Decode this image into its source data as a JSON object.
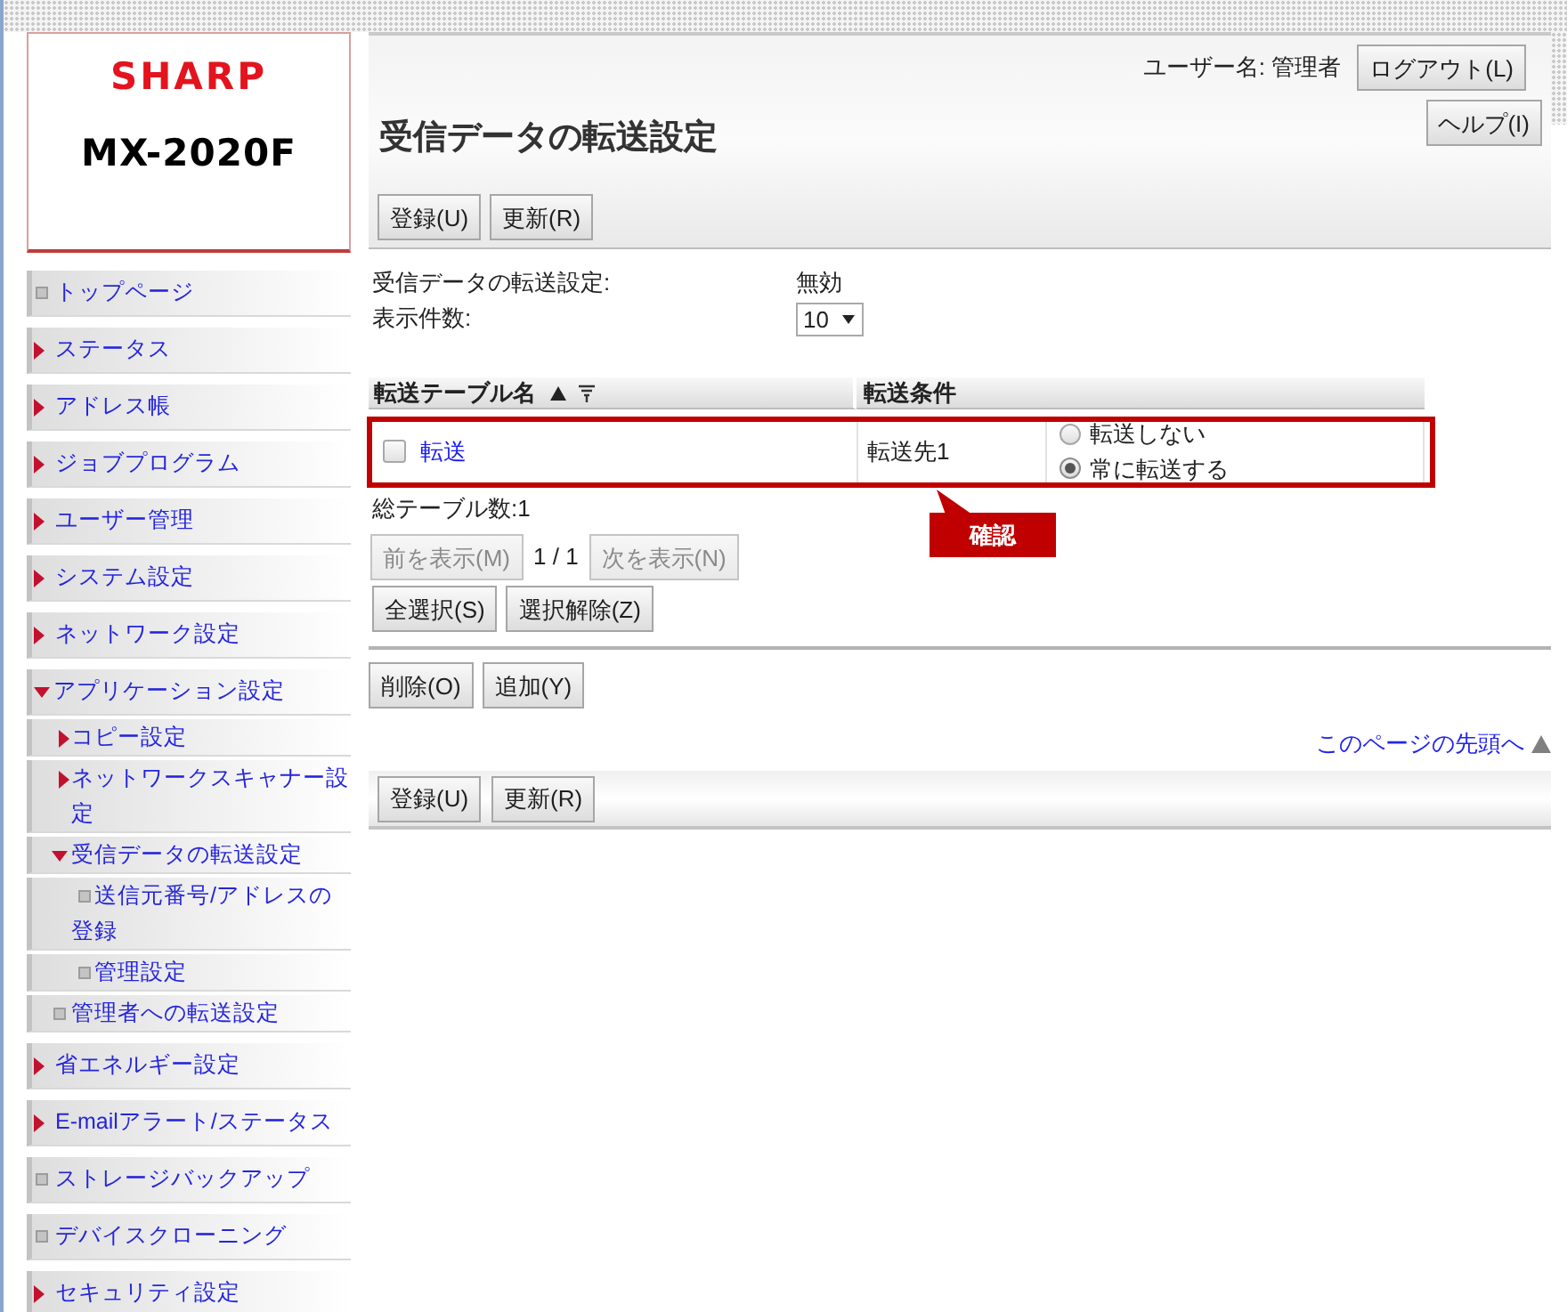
{
  "logo": {
    "brand": "SHARP",
    "model": "MX-2020F"
  },
  "sidebar": {
    "items": [
      {
        "label": "トップページ",
        "kind": "page"
      },
      {
        "label": "ステータス",
        "kind": "folder",
        "expanded": false
      },
      {
        "label": "アドレス帳",
        "kind": "folder",
        "expanded": false
      },
      {
        "label": "ジョブプログラム",
        "kind": "folder",
        "expanded": false
      },
      {
        "label": "ユーザー管理",
        "kind": "folder",
        "expanded": false
      },
      {
        "label": "システム設定",
        "kind": "folder",
        "expanded": false
      },
      {
        "label": "ネットワーク設定",
        "kind": "folder",
        "expanded": false
      },
      {
        "label": "アプリケーション設定",
        "kind": "folder",
        "expanded": true,
        "children": [
          {
            "label": "コピー設定",
            "kind": "folder",
            "expanded": false
          },
          {
            "label": "ネットワークスキャナー設定",
            "kind": "folder",
            "expanded": false
          },
          {
            "label": "受信データの転送設定",
            "kind": "folder",
            "expanded": true,
            "children": [
              {
                "label": "送信元番号/アドレスの登録",
                "kind": "page"
              },
              {
                "label": "管理設定",
                "kind": "page"
              }
            ]
          },
          {
            "label": "管理者への転送設定",
            "kind": "page"
          }
        ]
      },
      {
        "label": "省エネルギー設定",
        "kind": "folder",
        "expanded": false
      },
      {
        "label": "E-mailアラート/ステータス",
        "kind": "folder",
        "expanded": false
      },
      {
        "label": "ストレージバックアップ",
        "kind": "page"
      },
      {
        "label": "デバイスクローニング",
        "kind": "page"
      },
      {
        "label": "セキュリティ設定",
        "kind": "folder",
        "expanded": false
      }
    ]
  },
  "header": {
    "user": "ユーザー名: 管理者",
    "logout": "ログアウト(L)",
    "help": "ヘルプ(I)"
  },
  "title": "受信データの転送設定",
  "top_toolbar": {
    "buttons": [
      "登録(U)",
      "更新(R)"
    ]
  },
  "settings": [
    {
      "kind": "text",
      "label": "受信データの転送設定:",
      "value": "無効"
    },
    {
      "kind": "select",
      "label": "表示件数:",
      "value": "10"
    }
  ],
  "table": {
    "columns": [
      {
        "label": "転送テーブル名",
        "sort_ascending": true,
        "filter": true
      },
      {
        "label": "転送条件"
      }
    ],
    "rows": [
      {
        "checked": false,
        "name": "転送",
        "destination": "転送先1",
        "options": [
          {
            "label": "転送しない",
            "selected": false
          },
          {
            "label": "常に転送する",
            "selected": true
          }
        ]
      }
    ]
  },
  "annotation": {
    "label": "確認"
  },
  "total": "総テーブル数:1",
  "pager": {
    "previous": {
      "label": "前を表示(M)",
      "disabled": true
    },
    "page": "1 / 1",
    "next": {
      "label": "次を表示(N)",
      "disabled": true
    }
  },
  "selection_buttons": [
    "全選択(S)",
    "選択解除(Z)"
  ],
  "action_buttons": [
    "削除(O)",
    "追加(Y)"
  ],
  "page_top_link": "このページの先頭へ",
  "bottom_toolbar": {
    "buttons": [
      "登録(U)",
      "更新(R)"
    ]
  }
}
